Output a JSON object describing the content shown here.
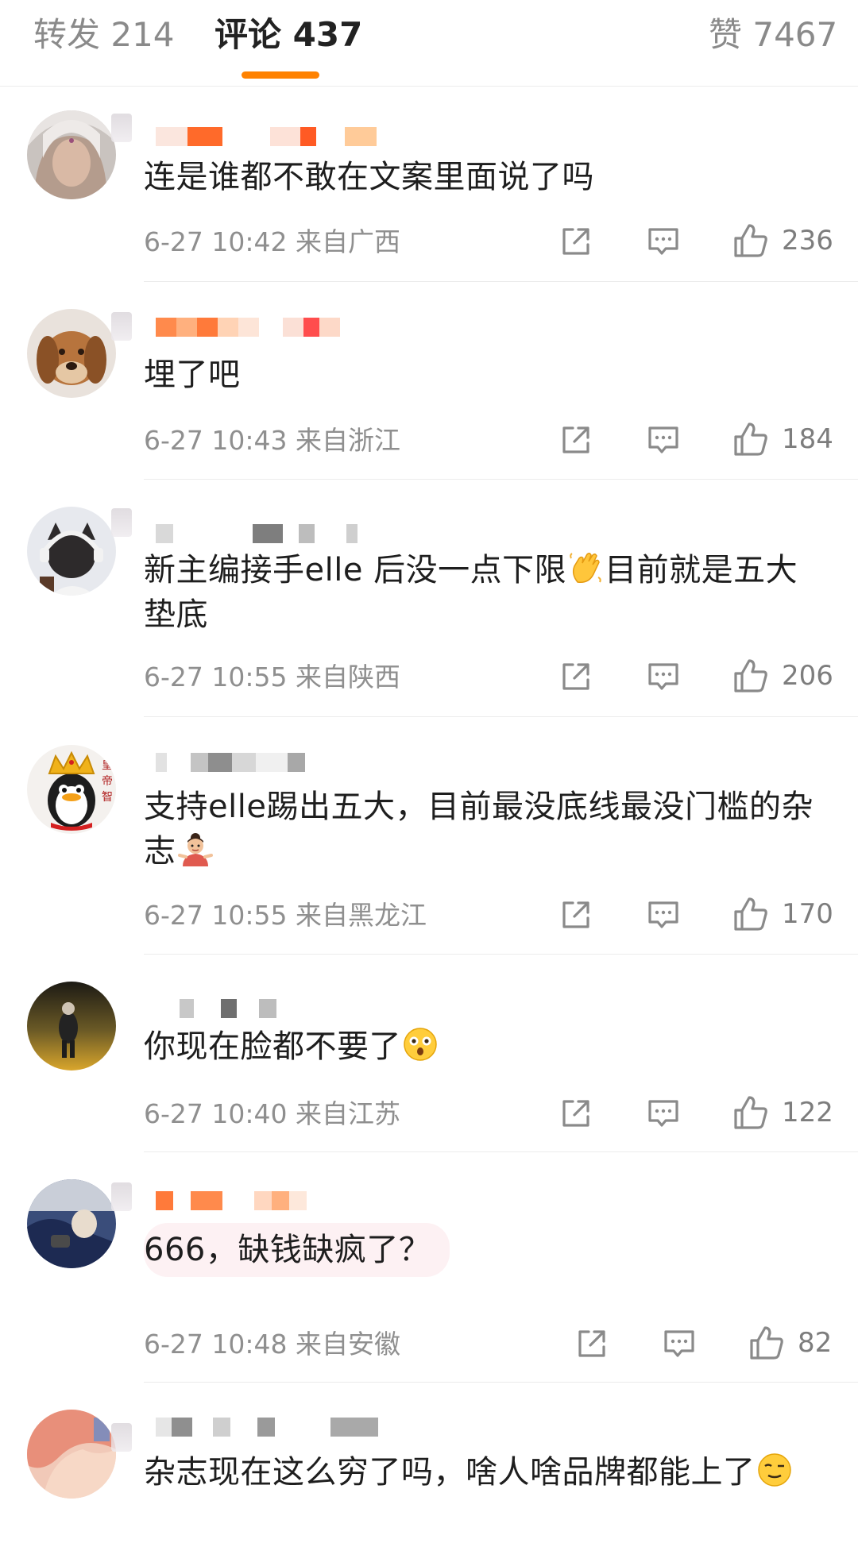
{
  "tabs": {
    "repost": "转发 214",
    "comments": "评论 437",
    "likes": "赞 7467"
  },
  "colors": {
    "accent": "#ff8200",
    "meta_text": "#8f8f8f",
    "divider": "#ececec"
  },
  "comments": [
    {
      "text": "连是谁都不敢在文案里面说了吗",
      "meta": "6-27 10:42 来自广西",
      "likes": "236"
    },
    {
      "text": "埋了吧",
      "meta": "6-27 10:43 来自浙江",
      "likes": "184"
    },
    {
      "text_a": "新主编接手elle 后没一点下限",
      "text_b": "目前就是五大垫底",
      "emoji": "waving-hand-emoji",
      "meta": "6-27 10:55 来自陕西",
      "likes": "206"
    },
    {
      "text_a": "支持elle踢出五大，目前最没底线最没门槛的杂志",
      "emoji": "shrugging-girl-emoji",
      "meta": "6-27 10:55 来自黑龙江",
      "likes": "170"
    },
    {
      "text_a": "你现在脸都不要了",
      "emoji": "astonished-face-emoji",
      "meta": "6-27 10:40 来自江苏",
      "likes": "122"
    },
    {
      "text": "666，缺钱缺疯了？",
      "meta": "6-27 10:48 来自安徽",
      "likes": "82"
    },
    {
      "text_a": "杂志现在这么穷了吗，啥人啥品牌都能上了",
      "emoji": "wink-face-emoji"
    }
  ],
  "icons": {
    "share": "share-icon",
    "reply": "reply-icon",
    "like": "thumbs-up-icon"
  }
}
